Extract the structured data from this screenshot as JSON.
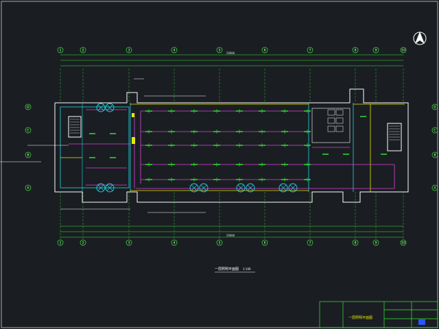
{
  "drawing": {
    "background": "#1a1e22",
    "frame_color": "#d9d9d9",
    "wall_color": "#ffffff",
    "circuit_color": "#e040e0",
    "fixture_color": "#33ee33",
    "accent_cyan": "#22d8e8",
    "accent_yellow": "#e8e800",
    "grid_bubble_color": "#33ee33",
    "title_caption": "一层照明平面图",
    "title_scale": "1:100",
    "titleblock_name": "一层照明平面图",
    "total_dimension_top": "58800",
    "total_dimension_bottom": "58800"
  },
  "axis_labels_horizontal": [
    "1",
    "2",
    "3",
    "4",
    "5",
    "6",
    "7",
    "8",
    "9",
    "10"
  ],
  "axis_labels_vertical": [
    "D",
    "C",
    "B",
    "A"
  ],
  "icons": {
    "north_arrow": "north-arrow-icon"
  }
}
